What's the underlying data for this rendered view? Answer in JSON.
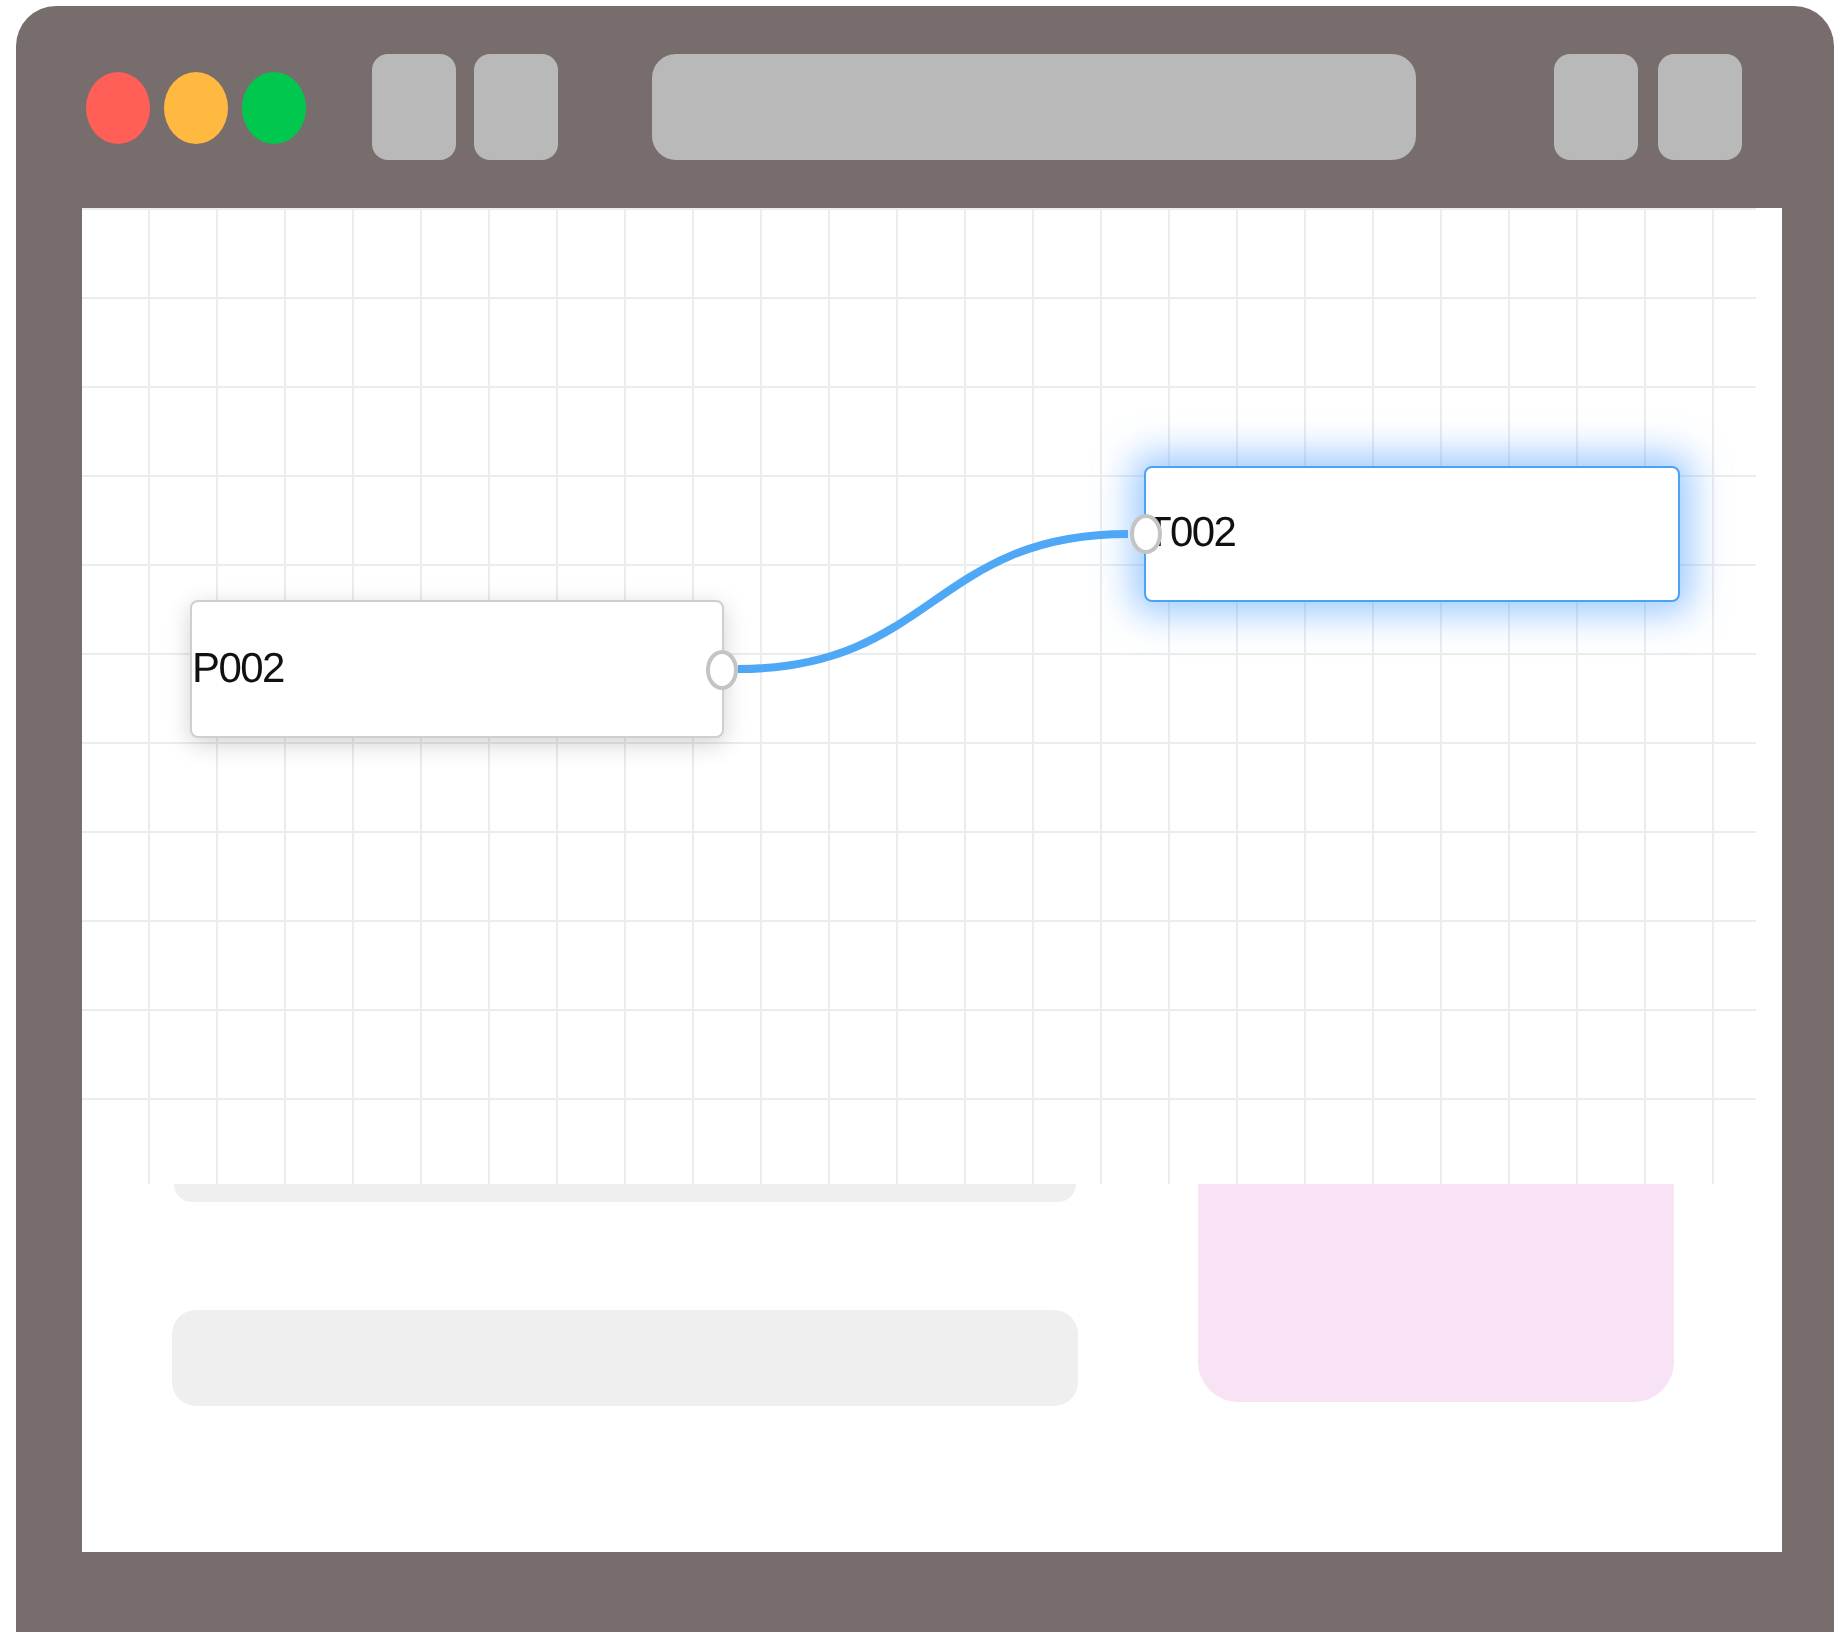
{
  "diagram": {
    "nodes": [
      {
        "label": "P002",
        "selected": false
      },
      {
        "label": "T002",
        "selected": true
      }
    ]
  }
}
